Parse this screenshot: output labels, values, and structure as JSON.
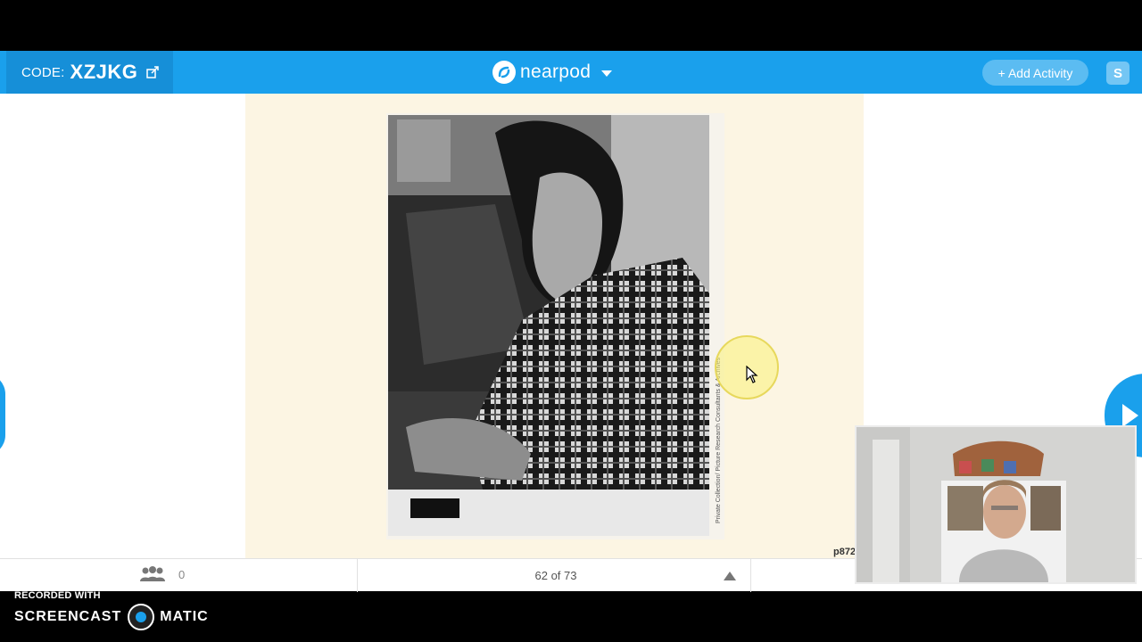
{
  "header": {
    "code_label": "CODE:",
    "code_value": "XZJKG",
    "brand_name": "nearpod",
    "add_activity_label": "+ Add Activity",
    "user_badge": "S"
  },
  "slide": {
    "photo_credit": "Private Collection/ Picture Research Consultants & Archives",
    "page_ref": "p872"
  },
  "footer": {
    "student_count": "0",
    "slide_position": "62 of 73"
  },
  "watermark": {
    "recorded_with": "RECORDED WITH",
    "brand_left": "SCREENCAST",
    "brand_right": "MATIC"
  },
  "colors": {
    "brand_blue": "#1aa0ec",
    "slide_background": "#fcf5e3",
    "cursor_highlight": "#f5eb6e"
  },
  "icons": [
    "share-icon",
    "nearpod-logo-icon",
    "dropdown-caret-icon",
    "students-icon",
    "caret-up-icon",
    "play-icon",
    "mouse-cursor-icon",
    "screencast-logo-icon"
  ]
}
